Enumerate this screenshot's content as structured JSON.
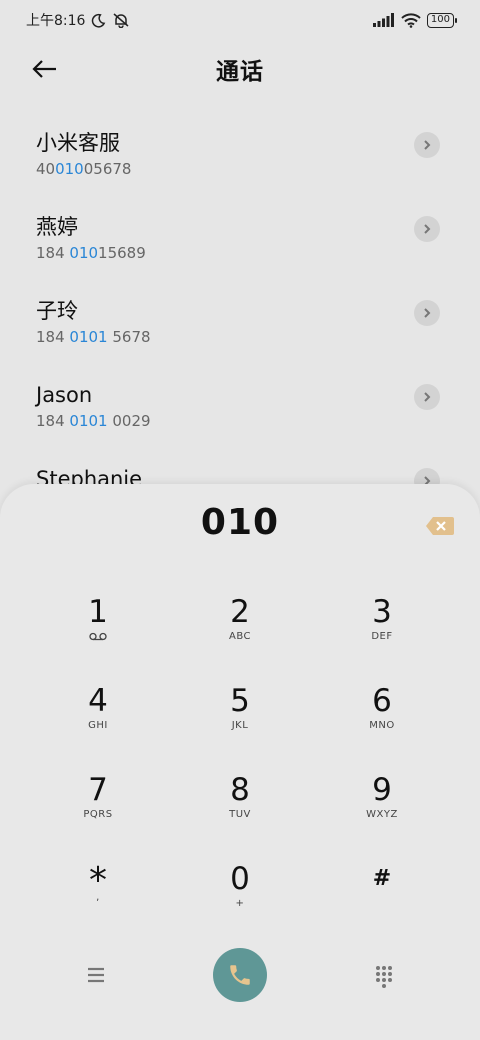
{
  "status_bar": {
    "time": "上午8:16",
    "battery": "100"
  },
  "header": {
    "title": "通话"
  },
  "contacts": [
    {
      "name": "小米客服",
      "number_pre": "40",
      "number_match": "010",
      "number_post": "05678"
    },
    {
      "name": "燕婷",
      "number_pre": "184 ",
      "number_match": "010",
      "number_post": "15689"
    },
    {
      "name": "子玲",
      "number_pre": "184 ",
      "number_match": "0101",
      "number_post": " 5678"
    },
    {
      "name": "Jason",
      "number_pre": "184 ",
      "number_match": "0101",
      "number_post": " 0029"
    },
    {
      "name": "Stephanie",
      "number_pre": "",
      "number_match": "",
      "number_post": ""
    }
  ],
  "dialer": {
    "input": "010",
    "keys": [
      {
        "digit": "1",
        "letters": ""
      },
      {
        "digit": "2",
        "letters": "ABC"
      },
      {
        "digit": "3",
        "letters": "DEF"
      },
      {
        "digit": "4",
        "letters": "GHI"
      },
      {
        "digit": "5",
        "letters": "JKL"
      },
      {
        "digit": "6",
        "letters": "MNO"
      },
      {
        "digit": "7",
        "letters": "PQRS"
      },
      {
        "digit": "8",
        "letters": "TUV"
      },
      {
        "digit": "9",
        "letters": "WXYZ"
      },
      {
        "digit": "*",
        "letters": ","
      },
      {
        "digit": "0",
        "letters": "+"
      },
      {
        "digit": "#",
        "letters": ""
      }
    ]
  },
  "icons": {
    "back": "back-arrow-icon",
    "detail": "chevron-right-icon",
    "backspace": "backspace-icon",
    "voicemail": "voicemail-icon",
    "menu": "menu-icon",
    "call": "phone-icon",
    "keypad": "dialpad-icon"
  },
  "colors": {
    "accent_match": "#2a86d6",
    "call_button": "#5f9796",
    "backspace": "#e2c08d"
  }
}
